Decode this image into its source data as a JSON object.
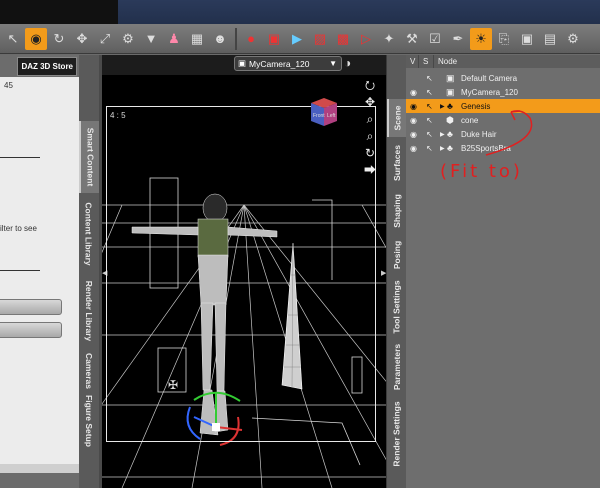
{
  "store": {
    "label": "DAZ 3D Store"
  },
  "content": {
    "count": "45",
    "hint": "ilter to see"
  },
  "left_tabs": [
    "Smart Content",
    "Content Library",
    "Render Library",
    "Cameras",
    "Figure Setup"
  ],
  "viewport": {
    "camera": "MyCamera_120",
    "aspect": "4 : 5",
    "cube_front": "Front",
    "cube_left": "Left"
  },
  "right_tabs": [
    "Scene",
    "Surfaces",
    "Shaping",
    "Posing",
    "Tool Settings",
    "Parameters",
    "Render Settings"
  ],
  "scene": {
    "columns": [
      "V",
      "S",
      "Node"
    ],
    "nodes": [
      {
        "label": "Default Camera"
      },
      {
        "label": "MyCamera_120"
      },
      {
        "label": "Genesis"
      },
      {
        "label": "cone"
      },
      {
        "label": "Duke Hair"
      },
      {
        "label": "B25SportsBra"
      }
    ]
  },
  "annotation": {
    "text": "(Fit to)"
  },
  "colors": {
    "accent": "#f39b1a",
    "annotation": "#e02020"
  }
}
